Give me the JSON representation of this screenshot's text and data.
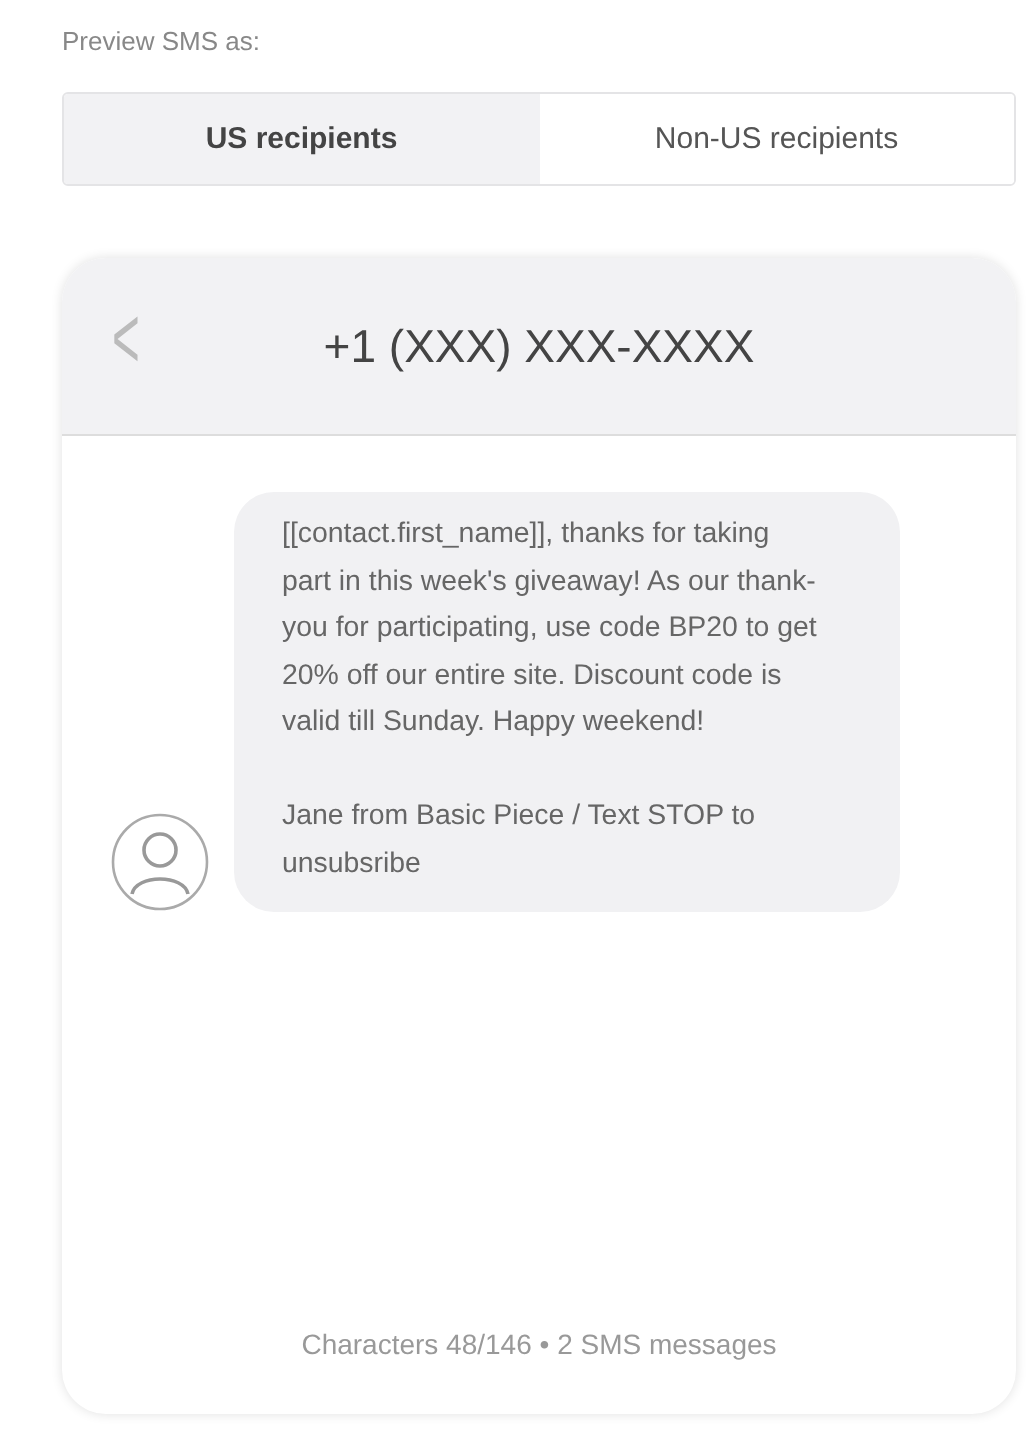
{
  "label": "Preview SMS as:",
  "tabs": [
    {
      "label": "US recipients",
      "selected": true
    },
    {
      "label": "Non-US recipients",
      "selected": false
    }
  ],
  "phone": {
    "back": "<",
    "number": "+1 (XXX) XXX-XXXX",
    "message": [
      "[[contact.first_name]], thanks for taking part in this week's giveaway! As our thank-you for participating, use code BP20 to get 20% off our entire site. Discount code is valid till Sunday. Happy weekend!",
      "Jane from Basic Piece / Text STOP to unsubsribe"
    ],
    "footer": "Characters 48/146 • 2 SMS messages"
  }
}
